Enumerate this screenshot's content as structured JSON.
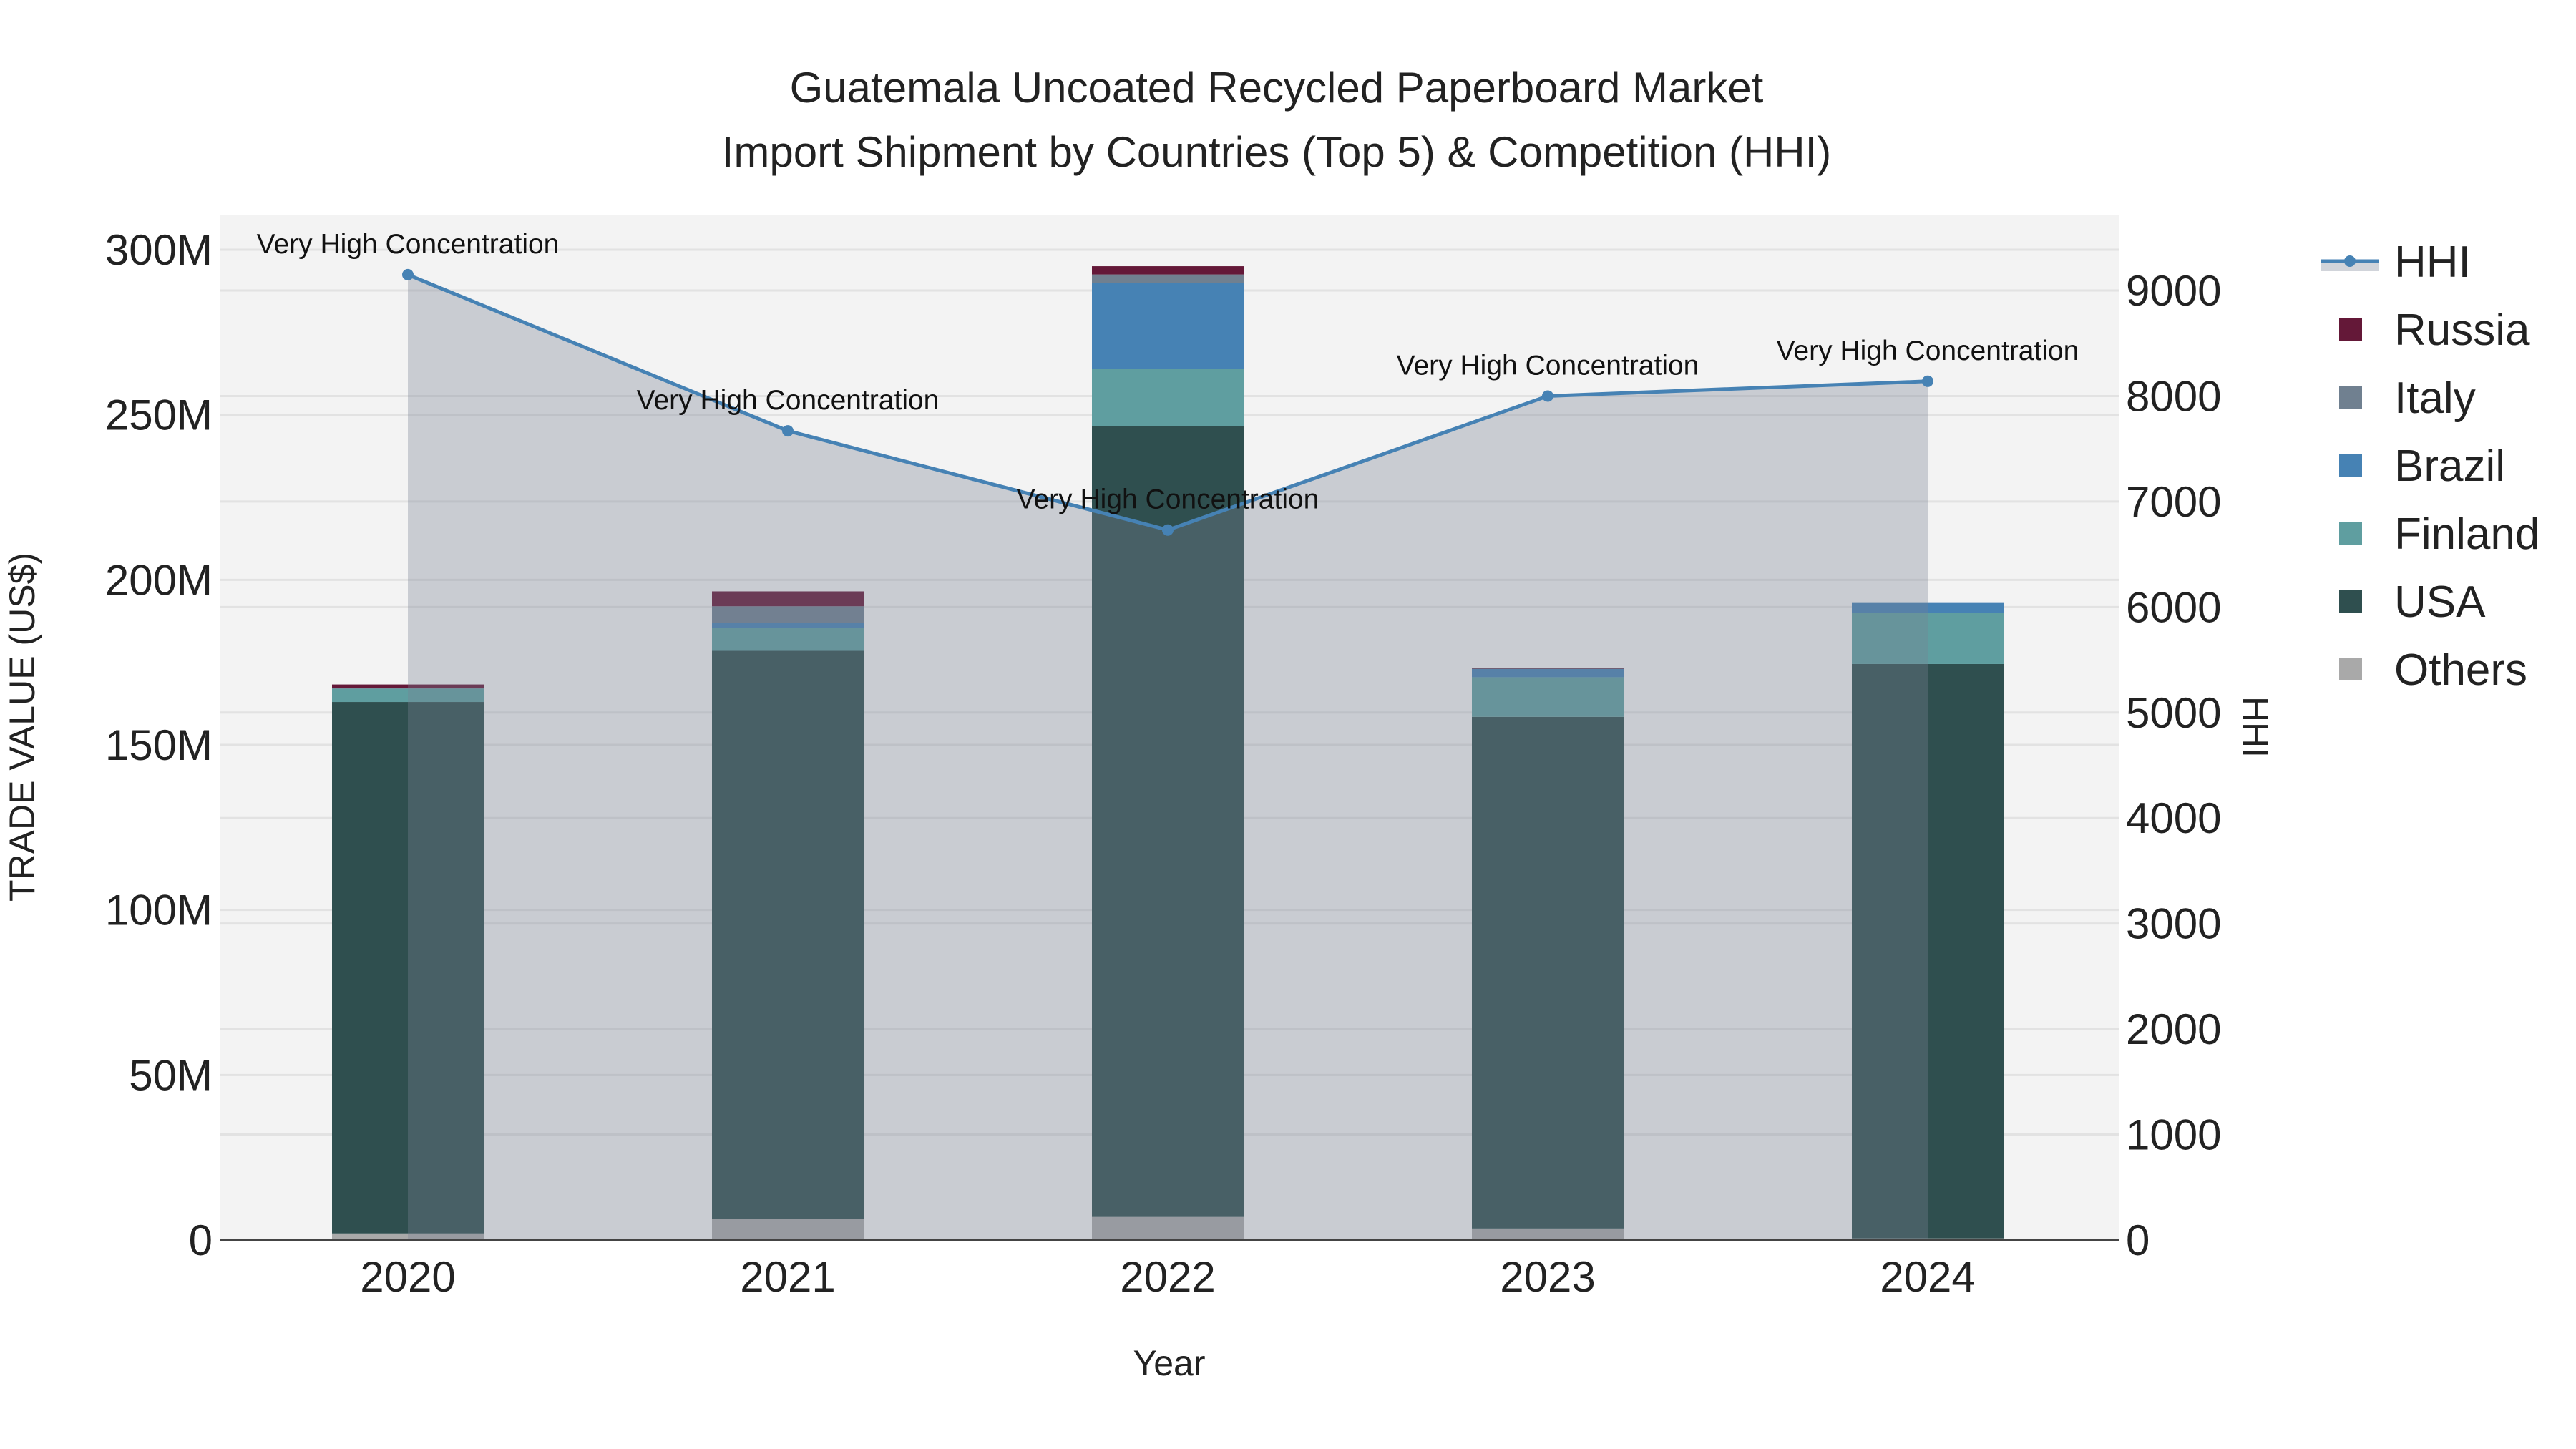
{
  "chart_data": {
    "type": "bar",
    "stacked": true,
    "title_lines": [
      "Guatemala Uncoated Recycled Paperboard Market",
      "Import Shipment by Countries (Top 5) & Competition (HHI)"
    ],
    "xlabel": "Year",
    "ylabel": "TRADE VALUE (US$)",
    "y2label": "HHI",
    "categories": [
      "2020",
      "2021",
      "2022",
      "2023",
      "2024"
    ],
    "ylim": [
      0,
      310
    ],
    "y_unit": "M",
    "yticks": [
      "0",
      "50M",
      "100M",
      "150M",
      "200M",
      "250M",
      "300M"
    ],
    "y2lim": [
      0,
      9700
    ],
    "y2ticks": [
      "0",
      "1000",
      "2000",
      "3000",
      "4000",
      "5000",
      "6000",
      "7000",
      "8000",
      "9000"
    ],
    "grid": true,
    "legend_position": "right",
    "series": [
      {
        "name": "Others",
        "color": "#a9a9a9",
        "values": [
          2,
          6.5,
          7,
          3.5,
          0.5
        ]
      },
      {
        "name": "USA",
        "color": "#2f4f4f",
        "values": [
          161,
          172,
          239.5,
          155,
          174
        ]
      },
      {
        "name": "Finland",
        "color": "#5f9ea0",
        "values": [
          4,
          7,
          17.5,
          12,
          15.5
        ]
      },
      {
        "name": "Brazil",
        "color": "#4682b4",
        "values": [
          0,
          1.5,
          26,
          2.5,
          3
        ]
      },
      {
        "name": "Italy",
        "color": "#708090",
        "values": [
          0.3,
          5,
          2.5,
          0.2,
          0
        ]
      },
      {
        "name": "Russia",
        "color": "#641838",
        "values": [
          1,
          4.5,
          2.5,
          0.1,
          0
        ]
      }
    ],
    "line_series": {
      "name": "HHI",
      "color": "#4682b4",
      "axis": "right",
      "values": [
        9150,
        7670,
        6730,
        8000,
        8140
      ],
      "annotations": [
        "Very High Concentration",
        "Very High Concentration",
        "Very High Concentration",
        "Very High Concentration",
        "Very High Concentration"
      ]
    },
    "legend_order": [
      "HHI",
      "Russia",
      "Italy",
      "Brazil",
      "Finland",
      "USA",
      "Others"
    ]
  }
}
